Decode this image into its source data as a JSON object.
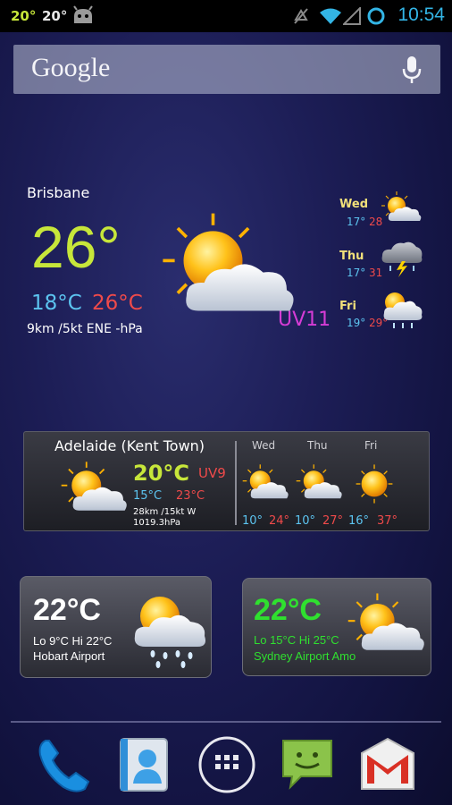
{
  "status_bar": {
    "temp_a": "20°",
    "temp_b": "20°",
    "time": "10:54"
  },
  "search": {
    "logo_text": "Google",
    "mic_icon": "microphone-icon"
  },
  "brisbane": {
    "city": "Brisbane",
    "temp": "26°",
    "low": "18°C",
    "high": "26°C",
    "wind": "9km /5kt ENE  -hPa",
    "uv": "UV11",
    "forecast": [
      {
        "day": "Wed",
        "low": "17°",
        "high": "28",
        "icon": "sun-cloud-icon"
      },
      {
        "day": "Thu",
        "low": "17°",
        "high": "31",
        "icon": "storm-icon"
      },
      {
        "day": "Fri",
        "low": "19°",
        "high": "29°",
        "icon": "sun-rain-icon"
      }
    ]
  },
  "adelaide": {
    "city": "Adelaide (Kent Town)",
    "temp": "20°C",
    "uv": "UV9",
    "low": "15°C",
    "high": "23°C",
    "wind": "28km /15kt W",
    "pressure": "1019.3hPa",
    "forecast": [
      {
        "day": "Wed",
        "low": "10°",
        "high": "24°"
      },
      {
        "day": "Thu",
        "low": "10°",
        "high": "27°"
      },
      {
        "day": "Fri",
        "low": "16°",
        "high": "37°"
      }
    ]
  },
  "hobart": {
    "temp": "22°C",
    "lohi": "Lo 9°C Hi 22°C",
    "place": "Hobart Airport"
  },
  "sydney": {
    "temp": "22°C",
    "lohi": "Lo 15°C Hi 25°C",
    "place": "Sydney Airport Amo"
  },
  "dock": [
    "phone-icon",
    "contacts-icon",
    "app-drawer-icon",
    "messaging-icon",
    "gmail-icon"
  ],
  "colors": {
    "accent_lime": "#c7e63a",
    "accent_blue": "#33b5e5",
    "hi_red": "#ef4a4a",
    "lo_blue": "#5cc4f0",
    "uv_magenta": "#d63cd6",
    "sydney_green": "#2fe02f"
  }
}
